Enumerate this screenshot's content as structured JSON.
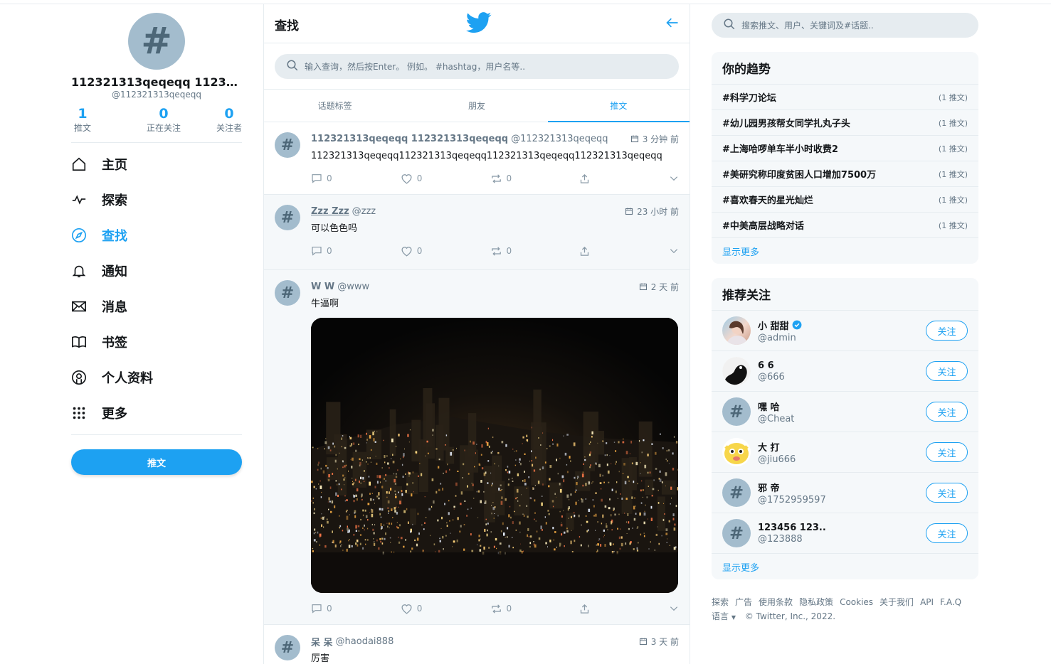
{
  "profile": {
    "name": "112321313qeqeqq 1123213...",
    "handle": "@112321313qeqeqq",
    "stats": [
      {
        "value": "1",
        "label": "推文"
      },
      {
        "value": "0",
        "label": "正在关注"
      },
      {
        "value": "0",
        "label": "关注者"
      }
    ]
  },
  "nav": [
    {
      "label": "主页",
      "icon": "home-icon"
    },
    {
      "label": "探索",
      "icon": "activity-icon"
    },
    {
      "label": "查找",
      "icon": "compass-icon",
      "active": true
    },
    {
      "label": "通知",
      "icon": "bell-icon"
    },
    {
      "label": "消息",
      "icon": "mail-icon"
    },
    {
      "label": "书签",
      "icon": "book-icon"
    },
    {
      "label": "个人资料",
      "icon": "at-icon"
    },
    {
      "label": "更多",
      "icon": "grid-dots-icon"
    }
  ],
  "tweet_button": "推文",
  "center": {
    "title": "查找",
    "search_placeholder": "输入查询，然后按Enter。 例如。 #hashtag，用户名等..",
    "tabs": [
      "话题标签",
      "朋友",
      "推文"
    ]
  },
  "tweets": [
    {
      "name": "112321313qeqeqq 112321313qeqeqq",
      "handle": "@112321313qeqeqq",
      "time": "3 分钟 前",
      "text": "112321313qeqeqq112321313qeqeqq112321313qeqeqq112321313qeqeqq",
      "comments": "0",
      "likes": "0",
      "retweets": "0"
    },
    {
      "name": "Zzz Zzz",
      "handle": "@zzz",
      "time": "23 小时 前",
      "text": "可以色色吗",
      "comments": "0",
      "likes": "0",
      "retweets": "0"
    },
    {
      "name": "W W",
      "handle": "@www",
      "time": "2 天 前",
      "text": "牛逼啊",
      "comments": "0",
      "likes": "0",
      "retweets": "0"
    },
    {
      "name": "呆 呆",
      "handle": "@haodai888",
      "time": "3 天 前",
      "text": "厉害"
    }
  ],
  "right": {
    "search_placeholder": "搜索推文、用户、关键词及#话题..",
    "trends_title": "你的趋势",
    "trends": [
      {
        "tag": "#科学刀论坛",
        "count": "(1 推文)"
      },
      {
        "tag": "#幼儿园男孩帮女同学扎丸子头",
        "count": "(1 推文)"
      },
      {
        "tag": "#上海哈啰单车半小时收费2",
        "count": "(1 推文)"
      },
      {
        "tag": "#美研究称印度贫困人口增加7500万",
        "count": "(1 推文)"
      },
      {
        "tag": "#喜欢春天的星光灿烂",
        "count": "(1 推文)"
      },
      {
        "tag": "#中美高层战略对话",
        "count": "(1 推文)"
      }
    ],
    "show_more": "显示更多",
    "follow_title": "推荐关注",
    "follows": [
      {
        "name": "小 甜甜",
        "handle": "@admin",
        "verified": true
      },
      {
        "name": "6 6",
        "handle": "@666"
      },
      {
        "name": "嘿 哈",
        "handle": "@Cheat"
      },
      {
        "name": "大 打",
        "handle": "@jiu666"
      },
      {
        "name": "邪 帝",
        "handle": "@1752959597"
      },
      {
        "name": "123456 123..",
        "handle": "@123888"
      }
    ],
    "follow_label": "关注",
    "footer_links": [
      "探索",
      "广告",
      "使用条款",
      "隐私政策",
      "Cookies",
      "关于我们",
      "API",
      "F.A.Q"
    ],
    "language": "语言",
    "copyright": "© Twitter, Inc., 2022."
  },
  "colors": {
    "accent": "#1da1f2",
    "avatar": "#a3bccd"
  }
}
